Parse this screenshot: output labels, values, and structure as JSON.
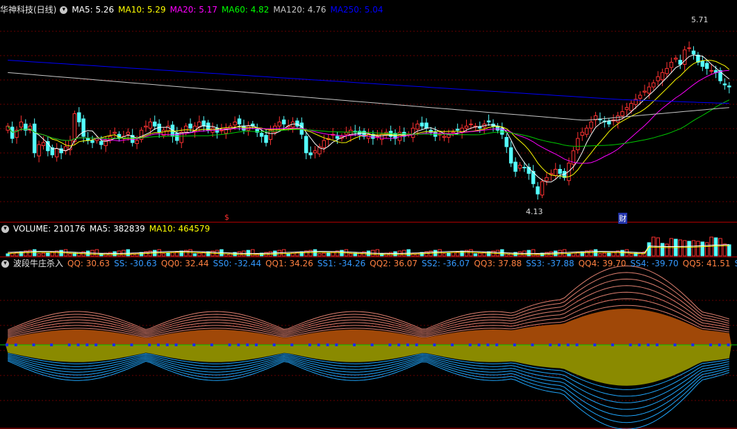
{
  "title": "华神科技(日线)",
  "main_legend": [
    {
      "label": "MA5",
      "value": "5.26",
      "color": "#ffffff"
    },
    {
      "label": "MA10",
      "value": "5.29",
      "color": "#ffff00"
    },
    {
      "label": "MA20",
      "value": "5.17",
      "color": "#ff00ff"
    },
    {
      "label": "MA60",
      "value": "4.82",
      "color": "#00ff00"
    },
    {
      "label": "MA120",
      "value": "4.76",
      "color": "#c8c8c8"
    },
    {
      "label": "MA250",
      "value": "5.04",
      "color": "#0000ff"
    }
  ],
  "volume_legend": [
    {
      "label": "VOLUME",
      "value": "210176",
      "color": "#ffffff"
    },
    {
      "label": "MA5",
      "value": "382839",
      "color": "#ffffff"
    },
    {
      "label": "MA10",
      "value": "464579",
      "color": "#ffff00"
    }
  ],
  "indicator_name": "波段牛庄杀入",
  "indicator_legend": [
    {
      "label": "QQ",
      "value": "30.63",
      "color": "#ff8040"
    },
    {
      "label": "SS",
      "value": "-30.63",
      "color": "#3399ff"
    },
    {
      "label": "QQ0",
      "value": "32.44",
      "color": "#ff8040"
    },
    {
      "label": "SS0",
      "value": "-32.44",
      "color": "#3399ff"
    },
    {
      "label": "QQ1",
      "value": "34.26",
      "color": "#ff8040"
    },
    {
      "label": "SS1",
      "value": "-34.26",
      "color": "#3399ff"
    },
    {
      "label": "QQ2",
      "value": "36.07",
      "color": "#ff8040"
    },
    {
      "label": "SS2",
      "value": "-36.07",
      "color": "#3399ff"
    },
    {
      "label": "QQ3",
      "value": "37.88",
      "color": "#ff8040"
    },
    {
      "label": "SS3",
      "value": "-37.88",
      "color": "#3399ff"
    },
    {
      "label": "QQ4",
      "value": "39.70",
      "color": "#ff8040"
    },
    {
      "label": "SS4",
      "value": "-39.70",
      "color": "#3399ff"
    },
    {
      "label": "QQ5",
      "value": "41.51",
      "color": "#ff8040"
    },
    {
      "label": "SS5",
      "value": "-41.51",
      "color": "#3399ff"
    },
    {
      "label": "QQ6",
      "value": "",
      "color": "#ff8040"
    }
  ],
  "annotations": {
    "high_label": "5.71",
    "low_label": "4.13",
    "marker_s": "$",
    "marker_cai": "财"
  },
  "chart_data": [
    {
      "type": "candlestick",
      "panel": "price",
      "ylim": [
        3.95,
        5.95
      ],
      "high": 5.71,
      "low": 4.13,
      "series": [
        {
          "name": "MA5",
          "values": []
        },
        {
          "name": "MA10",
          "values": []
        },
        {
          "name": "MA20",
          "values": []
        },
        {
          "name": "MA60",
          "values": []
        },
        {
          "name": "MA120",
          "values": []
        },
        {
          "name": "MA250",
          "values": []
        }
      ],
      "ohlc_closes": [
        4.86,
        4.74,
        4.82,
        4.9,
        4.82,
        4.86,
        4.6,
        4.68,
        4.7,
        4.62,
        4.58,
        4.64,
        4.6,
        4.66,
        4.72,
        4.98,
        4.9,
        4.76,
        4.72,
        4.7,
        4.74,
        4.68,
        4.72,
        4.76,
        4.8,
        4.74,
        4.76,
        4.8,
        4.7,
        4.72,
        4.82,
        4.86,
        4.9,
        4.86,
        4.8,
        4.82,
        4.86,
        4.76,
        4.72,
        4.8,
        4.86,
        4.84,
        4.86,
        4.9,
        4.86,
        4.82,
        4.84,
        4.8,
        4.82,
        4.84,
        4.86,
        4.9,
        4.88,
        4.82,
        4.86,
        4.86,
        4.8,
        4.76,
        4.7,
        4.82,
        4.86,
        4.9,
        4.88,
        4.86,
        4.9,
        4.86,
        4.78,
        4.6,
        4.58,
        4.62,
        4.66,
        4.72,
        4.74,
        4.78,
        4.74,
        4.76,
        4.8,
        4.82,
        4.8,
        4.78,
        4.76,
        4.78,
        4.74,
        4.76,
        4.78,
        4.8,
        4.76,
        4.74,
        4.8,
        4.76,
        4.78,
        4.84,
        4.88,
        4.86,
        4.84,
        4.8,
        4.76,
        4.78,
        4.76,
        4.78,
        4.8,
        4.82,
        4.84,
        4.86,
        4.88,
        4.86,
        4.84,
        4.88,
        4.9,
        4.86,
        4.82,
        4.78,
        4.66,
        4.5,
        4.42,
        4.48,
        4.46,
        4.4,
        4.3,
        4.2,
        4.32,
        4.36,
        4.4,
        4.44,
        4.4,
        4.36,
        4.5,
        4.62,
        4.74,
        4.8,
        4.84,
        4.9,
        4.96,
        4.92,
        4.9,
        4.88,
        4.92,
        4.96,
        5.0,
        5.04,
        5.08,
        5.12,
        5.16,
        5.2,
        5.24,
        5.28,
        5.34,
        5.38,
        5.42,
        5.48,
        5.52,
        5.46,
        5.6,
        5.62,
        5.56,
        5.48,
        5.44,
        5.42,
        5.4,
        5.38,
        5.3,
        5.26,
        5.24
      ]
    },
    {
      "type": "bar",
      "panel": "volume",
      "series": [
        {
          "name": "VOLUME",
          "values": []
        },
        {
          "name": "MA5",
          "values": []
        },
        {
          "name": "MA10",
          "values": []
        }
      ]
    },
    {
      "type": "area",
      "panel": "indicator",
      "series": [
        {
          "name": "QQ",
          "values": []
        },
        {
          "name": "SS",
          "values": []
        }
      ]
    }
  ]
}
